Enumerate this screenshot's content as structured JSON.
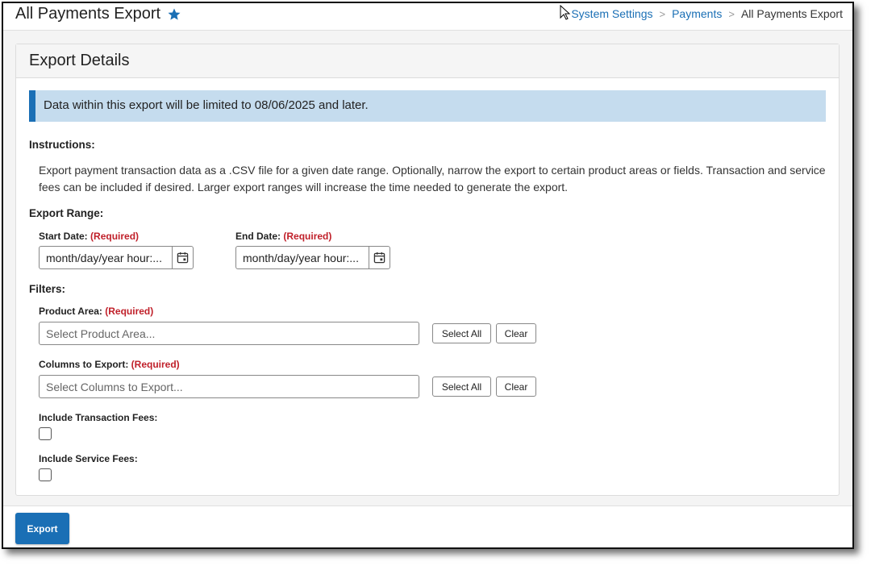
{
  "header": {
    "title": "All Payments Export",
    "breadcrumb": [
      "System Settings",
      "Payments",
      "All Payments Export"
    ]
  },
  "card": {
    "title": "Export Details",
    "alert": "Data within this export will be limited to 08/06/2025 and later.",
    "instructions_label": "Instructions:",
    "instructions_text": "Export payment transaction data as a .CSV file for a given date range. Optionally, narrow the export to certain product areas or fields. Transaction and service fees can be included if desired. Larger export ranges will increase the time needed to generate the export.",
    "export_range_label": "Export Range:",
    "start_date": {
      "label": "Start Date:",
      "required": "(Required)",
      "placeholder": "month/day/year hour:..."
    },
    "end_date": {
      "label": "End Date:",
      "required": "(Required)",
      "placeholder": "month/day/year hour:..."
    },
    "filters_label": "Filters:",
    "product_area": {
      "label": "Product Area:",
      "required": "(Required)",
      "placeholder": "Select Product Area...",
      "select_all": "Select All",
      "clear": "Clear"
    },
    "columns": {
      "label": "Columns to Export:",
      "required": "(Required)",
      "placeholder": "Select Columns to Export...",
      "select_all": "Select All",
      "clear": "Clear"
    },
    "transaction_fees_label": "Include Transaction Fees:",
    "service_fees_label": "Include Service Fees:"
  },
  "footer": {
    "export_label": "Export"
  },
  "colors": {
    "accent": "#1a6fb5",
    "alert_bg": "#c5dcee",
    "required": "#c0202a"
  },
  "icons": [
    "star-icon",
    "chevron-right-icon",
    "calendar-icon",
    "cursor-icon"
  ]
}
